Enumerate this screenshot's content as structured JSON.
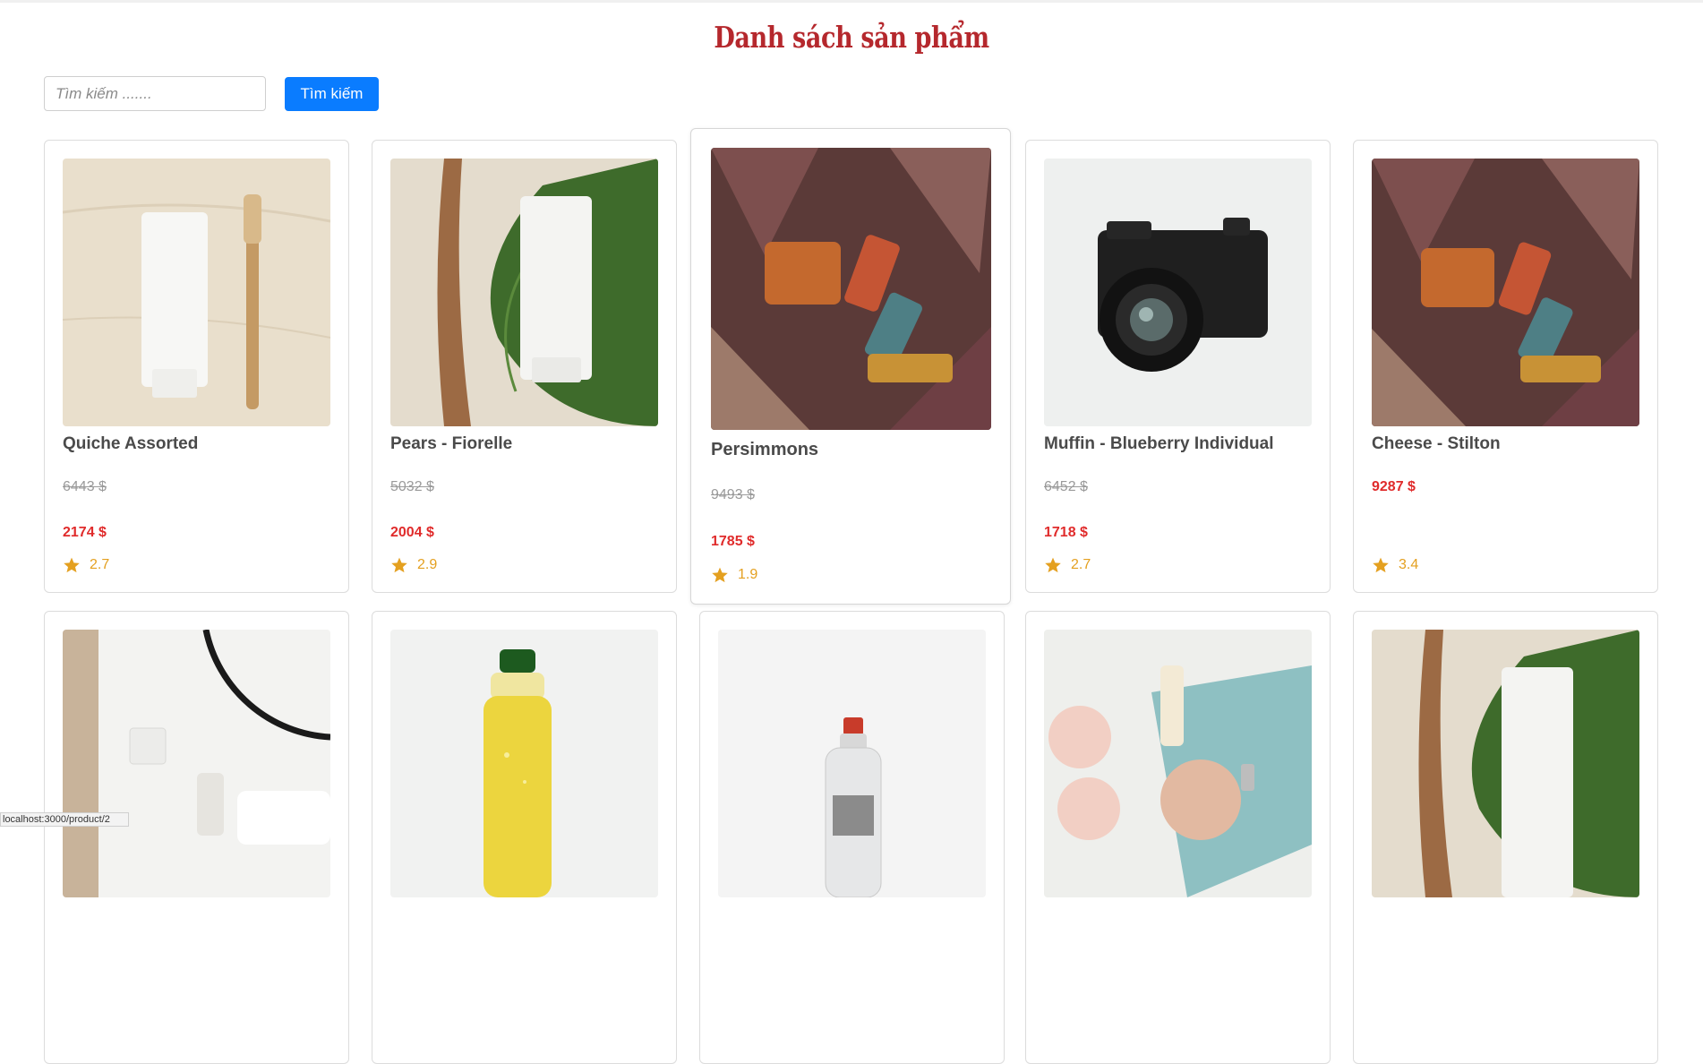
{
  "page": {
    "title": "Danh sách sản phẩm",
    "accent_color": "#b5282d",
    "price_color": "#e02b2b",
    "rating_color": "#e4a020",
    "button_color": "#0a7cff"
  },
  "search": {
    "placeholder": "Tìm kiếm .......",
    "value": "",
    "button_label": "Tìm kiếm",
    "icon": null
  },
  "products": [
    {
      "name": "Quiche Assorted",
      "old_price": "6443 $",
      "price": "2174 $",
      "rating": "2.7",
      "image": "toothpaste-tube-and-bamboo-toothbrush"
    },
    {
      "name": "Pears - Fiorelle",
      "old_price": "5032 $",
      "price": "2004 $",
      "rating": "2.9",
      "image": "tube-on-chestnut-leaves"
    },
    {
      "name": "Persimmons",
      "old_price": "9493 $",
      "price": "1785 $",
      "rating": "1.9",
      "image": "cosmetics-on-autumn-leaves"
    },
    {
      "name": "Muffin - Blueberry Individual",
      "old_price": "6452 $",
      "price": "1718 $",
      "rating": "2.7",
      "image": "black-camera"
    },
    {
      "name": "Cheese - Stilton",
      "old_price": "",
      "price": "9287 $",
      "rating": "3.4",
      "image": "cosmetics-on-autumn-leaves"
    },
    {
      "name": "",
      "old_price": "",
      "price": "",
      "rating": "",
      "image": "bathroom-sink-with-towel"
    },
    {
      "name": "",
      "old_price": "",
      "price": "",
      "rating": "",
      "image": "yellow-oil-bottle"
    },
    {
      "name": "",
      "old_price": "",
      "price": "",
      "rating": "",
      "image": "glass-bottle"
    },
    {
      "name": "",
      "old_price": "",
      "price": "",
      "rating": "",
      "image": "sunglasses-and-magazine"
    },
    {
      "name": "",
      "old_price": "",
      "price": "",
      "rating": "",
      "image": "tube-on-chestnut-leaves"
    }
  ],
  "status_bar": {
    "url": "localhost:3000/product/2"
  }
}
